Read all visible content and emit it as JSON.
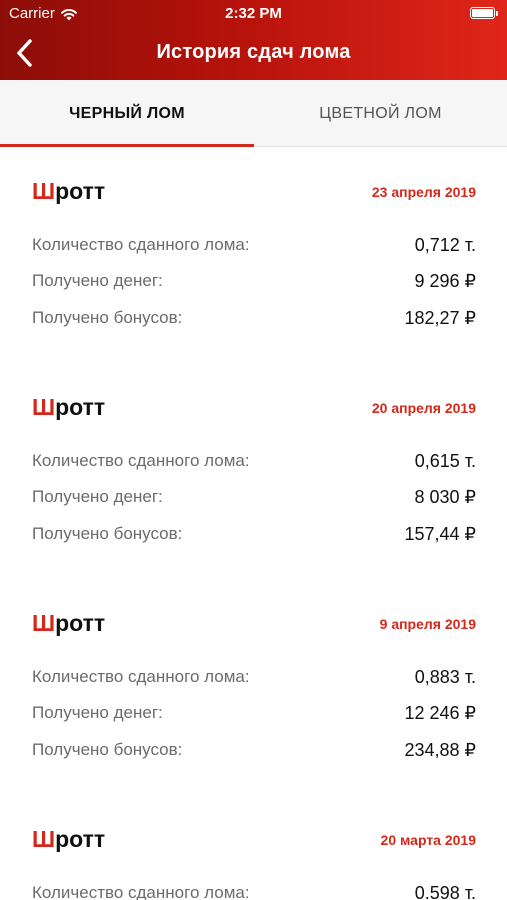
{
  "status_bar": {
    "carrier": "Carrier",
    "time": "2:32 PM"
  },
  "nav": {
    "title": "История сдач лома"
  },
  "tabs": [
    {
      "label": "ЧЕРНЫЙ ЛОМ",
      "active": true
    },
    {
      "label": "ЦВЕТНОЙ ЛОМ",
      "active": false
    }
  ],
  "labels": {
    "quantity": "Количество сданного лома:",
    "money": "Получено денег:",
    "bonus": "Получено бонусов:"
  },
  "records": [
    {
      "title_first": "Ш",
      "title_rest": "ротт",
      "date": "23 апреля 2019",
      "quantity": "0,712 т.",
      "money": "9 296 ₽",
      "bonus": "182,27 ₽"
    },
    {
      "title_first": "Ш",
      "title_rest": "ротт",
      "date": "20 апреля 2019",
      "quantity": "0,615 т.",
      "money": "8 030 ₽",
      "bonus": "157,44 ₽"
    },
    {
      "title_first": "Ш",
      "title_rest": "ротт",
      "date": "9 апреля 2019",
      "quantity": "0,883 т.",
      "money": "12 246 ₽",
      "bonus": "234,88 ₽"
    },
    {
      "title_first": "Ш",
      "title_rest": "ротт",
      "date": "20 марта 2019",
      "quantity": "0.598 т."
    }
  ],
  "colors": {
    "accent": "#d4281a",
    "header_dark": "#8c0d07",
    "header_light": "#e0261a"
  },
  "icons": {
    "back": "chevron-left-icon",
    "wifi": "wifi-icon",
    "battery": "battery-icon"
  }
}
